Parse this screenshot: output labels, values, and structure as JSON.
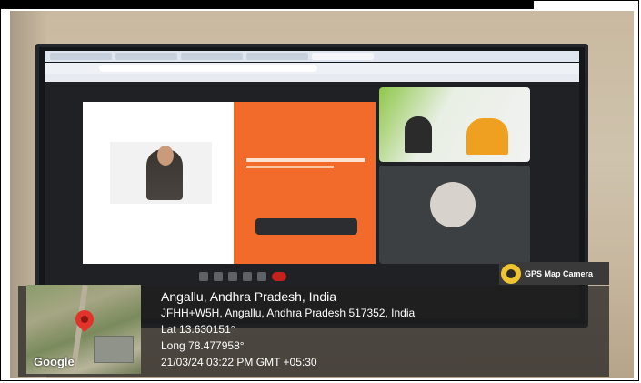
{
  "badge": {
    "label": "GPS Map Camera"
  },
  "location": {
    "place": "Angallu, Andhra Pradesh, India",
    "address": "JFHH+W5H, Angallu, Andhra Pradesh 517352, India",
    "latitude": "Lat 13.630151°",
    "longitude": "Long 78.477958°",
    "datetime": "21/03/24 03:22 PM GMT +05:30"
  },
  "map": {
    "provider_logo": "Google"
  },
  "colors": {
    "badge_icon": "#f0c430",
    "map_pin": "#e2322a",
    "slide_accent": "#f26b2b"
  }
}
